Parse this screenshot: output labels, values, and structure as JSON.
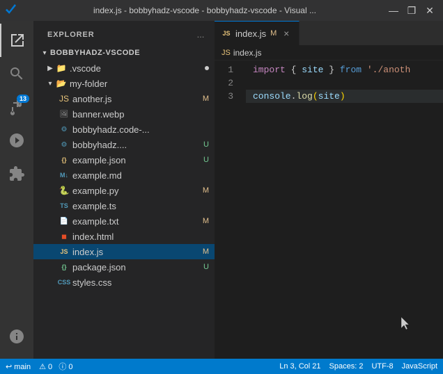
{
  "titleBar": {
    "title": "index.js - bobbyhadz-vscode - bobbyhadz-vscode - Visual ...",
    "controls": [
      "⬜",
      "❐",
      "✕"
    ]
  },
  "activityBar": {
    "items": [
      {
        "name": "explorer",
        "badge": null,
        "active": true
      },
      {
        "name": "search",
        "badge": null
      },
      {
        "name": "source-control",
        "badge": "13"
      },
      {
        "name": "run-debug",
        "badge": null
      },
      {
        "name": "extensions",
        "badge": null
      },
      {
        "name": "test",
        "badge": null
      }
    ]
  },
  "sidebar": {
    "title": "EXPLORER",
    "more_label": "...",
    "workspace": "BOBBYHADZ-VSCODE",
    "tree": [
      {
        "id": "vscode",
        "label": ".vscode",
        "type": "folder",
        "indent": 1,
        "expanded": false,
        "badge": "dot",
        "badgeType": "dot"
      },
      {
        "id": "myfolder",
        "label": "my-folder",
        "type": "folder-open",
        "indent": 1,
        "expanded": true
      },
      {
        "id": "anotherjs",
        "label": "another.js",
        "type": "js",
        "indent": 2,
        "badge": "M",
        "badgeType": "m"
      },
      {
        "id": "bannerwebp",
        "label": "banner.webp",
        "type": "webp",
        "indent": 2
      },
      {
        "id": "bobbyhadz",
        "label": "bobbyhadz.code-...",
        "type": "vscode",
        "indent": 2
      },
      {
        "id": "bobbyhadz2",
        "label": "bobbyhadz....",
        "type": "vscode",
        "indent": 2,
        "badge": "U",
        "badgeType": "u"
      },
      {
        "id": "examplejson",
        "label": "example.json",
        "type": "json",
        "indent": 2,
        "badge": "U",
        "badgeType": "u"
      },
      {
        "id": "examplemd",
        "label": "example.md",
        "type": "md",
        "indent": 2
      },
      {
        "id": "examplepy",
        "label": "example.py",
        "type": "py",
        "indent": 2,
        "badge": "M",
        "badgeType": "m"
      },
      {
        "id": "examplets",
        "label": "example.ts",
        "type": "ts",
        "indent": 2
      },
      {
        "id": "exampletxt",
        "label": "example.txt",
        "type": "txt",
        "indent": 2,
        "badge": "M",
        "badgeType": "m"
      },
      {
        "id": "indexhtml",
        "label": "index.html",
        "type": "html",
        "indent": 2
      },
      {
        "id": "indexjs",
        "label": "index.js",
        "type": "js",
        "indent": 2,
        "badge": "M",
        "badgeType": "m",
        "selected": true
      },
      {
        "id": "packagejson",
        "label": "package.json",
        "type": "json",
        "indent": 2,
        "badge": "U",
        "badgeType": "u"
      },
      {
        "id": "stylescss",
        "label": "styles.css",
        "type": "css",
        "indent": 2
      }
    ]
  },
  "tabs": [
    {
      "label": "index.js",
      "type": "js",
      "active": true,
      "modified": true,
      "modifiedLabel": "M"
    }
  ],
  "breadcrumb": {
    "filename": "index.js"
  },
  "editor": {
    "lines": [
      {
        "num": 1,
        "tokens": [
          {
            "type": "kw-import",
            "text": "import"
          },
          {
            "type": "punct",
            "text": " { "
          },
          {
            "type": "var-site",
            "text": "site"
          },
          {
            "type": "punct",
            "text": " } "
          },
          {
            "type": "kw-from",
            "text": "from"
          },
          {
            "type": "punct",
            "text": " "
          },
          {
            "type": "str",
            "text": "'./anoth"
          }
        ]
      },
      {
        "num": 2,
        "tokens": []
      },
      {
        "num": 3,
        "tokens": [
          {
            "type": "kw-console",
            "text": "console"
          },
          {
            "type": "punct",
            "text": "."
          },
          {
            "type": "fn",
            "text": "log"
          },
          {
            "type": "paren",
            "text": "("
          },
          {
            "type": "var-site",
            "text": "site"
          },
          {
            "type": "paren",
            "text": ")"
          }
        ],
        "highlighted": true
      }
    ]
  },
  "statusBar": {
    "left": [
      "↩ main",
      "⚠ 0  ⓘ 0"
    ],
    "right": [
      "Ln 3, Col 21",
      "Spaces: 2",
      "UTF-8",
      "JavaScript"
    ]
  }
}
